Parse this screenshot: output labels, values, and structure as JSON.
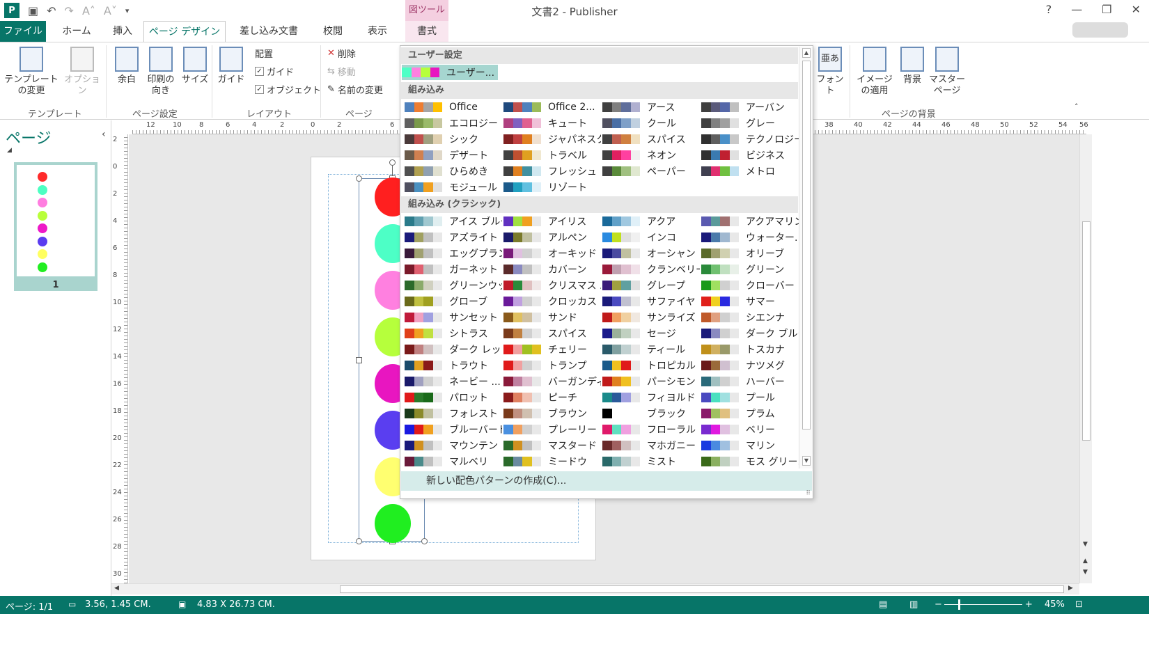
{
  "window": {
    "title": "文書2 - Publisher",
    "context_tool_label": "図ツール",
    "help": "?",
    "minimize": "—",
    "restore": "❐",
    "close": "✕"
  },
  "tabs": [
    {
      "label": "ファイル"
    },
    {
      "label": "ホーム"
    },
    {
      "label": "挿入"
    },
    {
      "label": "ページ デザイン"
    },
    {
      "label": "差し込み文書"
    },
    {
      "label": "校閲"
    },
    {
      "label": "表示"
    },
    {
      "label": "書式"
    }
  ],
  "ribbon": {
    "template_change": "テンプレートの変更",
    "options": "オプション",
    "margins": "余白",
    "orientation": "印刷の向き",
    "size": "サイズ",
    "guides": "ガイド",
    "align_label": "配置",
    "align_guides": "ガイド",
    "align_objects": "オブジェクト",
    "delete": "削除",
    "move": "移動",
    "rename": "名前の変更",
    "fonts": "フォント",
    "fonts_icon_text": "亜あ",
    "apply_image": "イメージの適用",
    "background": "背景",
    "master_pages": "マスター ページ",
    "groups": {
      "template": "テンプレート",
      "page_setup": "ページ設定",
      "layout": "レイアウト",
      "pages": "ページ",
      "page_background": "ページの背景"
    }
  },
  "pages_pane": {
    "title": "ページ",
    "thumb_number": "1",
    "thumb_dot_colors": [
      "#ff2a2a",
      "#4dffc2",
      "#ff7de0",
      "#b9ff3a",
      "#ee1ac8",
      "#5a3cf0",
      "#ffff60",
      "#22ee22"
    ]
  },
  "canvas": {
    "circle_colors": [
      "#ff1f1f",
      "#4dffc6",
      "#ff80e0",
      "#b6ff3c",
      "#e816c0",
      "#5a3ef0",
      "#ffff70",
      "#20ee20"
    ]
  },
  "hruler_numbers": [
    "12",
    "10",
    "8",
    "6",
    "4",
    "2",
    "0",
    "2",
    "6",
    "38",
    "40",
    "42",
    "44",
    "46",
    "48",
    "50",
    "52",
    "54",
    "56"
  ],
  "vruler_numbers": [
    "2",
    "0",
    "2",
    "4",
    "6",
    "8",
    "10",
    "12",
    "14",
    "16",
    "18",
    "20",
    "22",
    "24",
    "26",
    "28",
    "30"
  ],
  "dropdown": {
    "section_custom": "ユーザー設定",
    "section_builtin": "組み込み",
    "section_classic": "組み込み (クラシック)",
    "create_new": "新しい配色パターンの作成(C)...",
    "custom": [
      {
        "name": "ユーザー...",
        "colors": [
          "#4dffc6",
          "#ff80e0",
          "#b6ff3c",
          "#e816c0"
        ],
        "selected": true
      }
    ],
    "builtin": [
      {
        "name": "Office",
        "colors": [
          "#4f81bd",
          "#ed7d31",
          "#a5a5a5",
          "#ffc000"
        ]
      },
      {
        "name": "Office 2...",
        "colors": [
          "#1f497d",
          "#c0504d",
          "#4f81bd",
          "#9bbb59"
        ]
      },
      {
        "name": "アース",
        "colors": [
          "#404040",
          "#7f7f7f",
          "#5f6e9b",
          "#b0b0d0"
        ]
      },
      {
        "name": "アーバン",
        "colors": [
          "#404040",
          "#5b5b7b",
          "#5567a8",
          "#c0c0c0"
        ]
      },
      {
        "name": "エコロジー",
        "colors": [
          "#606060",
          "#7a9a4a",
          "#9aba6a",
          "#c8c8a0"
        ]
      },
      {
        "name": "キュート",
        "colors": [
          "#b04080",
          "#8060c0",
          "#e06090",
          "#f0c0d8"
        ]
      },
      {
        "name": "クール",
        "colors": [
          "#505060",
          "#4a6fa5",
          "#7fa0c8",
          "#c0d0e0"
        ]
      },
      {
        "name": "グレー",
        "colors": [
          "#404040",
          "#808080",
          "#a0a0a0",
          "#e0e0e0"
        ]
      },
      {
        "name": "シック",
        "colors": [
          "#4a3a3a",
          "#c0504d",
          "#a0a080",
          "#e0d0b0"
        ]
      },
      {
        "name": "ジャパネスク",
        "colors": [
          "#802020",
          "#c04040",
          "#e08020",
          "#f0e0d0"
        ]
      },
      {
        "name": "スパイス",
        "colors": [
          "#404040",
          "#c06050",
          "#d08040",
          "#f0e0c0"
        ]
      },
      {
        "name": "テクノロジー",
        "colors": [
          "#303030",
          "#5f5f5f",
          "#4a90c8",
          "#c8c8c8"
        ]
      },
      {
        "name": "デザート",
        "colors": [
          "#6a5a4a",
          "#d08050",
          "#90a0c0",
          "#e0d8c8"
        ]
      },
      {
        "name": "トラベル",
        "colors": [
          "#404040",
          "#c05030",
          "#e0a020",
          "#f0e8d0"
        ]
      },
      {
        "name": "ネオン",
        "colors": [
          "#404040",
          "#e02060",
          "#ff40a0",
          "#f0f0f0"
        ]
      },
      {
        "name": "ビジネス",
        "colors": [
          "#303030",
          "#3a7ab0",
          "#c02030",
          "#e0e0e0"
        ]
      },
      {
        "name": "ひらめき",
        "colors": [
          "#505050",
          "#b0a050",
          "#90a0b0",
          "#e0e0d0"
        ]
      },
      {
        "name": "フレッシュ",
        "colors": [
          "#404040",
          "#e08020",
          "#4090a0",
          "#d0e8f0"
        ]
      },
      {
        "name": "ペーパー",
        "colors": [
          "#404040",
          "#5a8a3a",
          "#a0c080",
          "#e0e8d0"
        ]
      },
      {
        "name": "メトロ",
        "colors": [
          "#404050",
          "#e03070",
          "#70c040",
          "#c0e0f0"
        ]
      },
      {
        "name": "モジュール",
        "colors": [
          "#505060",
          "#4a90c0",
          "#f0a020",
          "#e0e0e0"
        ]
      },
      {
        "name": "リゾート",
        "colors": [
          "#1a5a8a",
          "#20a0c0",
          "#60c0e0",
          "#e0f0f8"
        ]
      }
    ],
    "classic": [
      {
        "name": "アイス ブルー",
        "colors": [
          "#2a7a8a",
          "#60a0b0",
          "#a0c8d0",
          "#e0eef0"
        ]
      },
      {
        "name": "アイリス",
        "colors": [
          "#6030c0",
          "#a0e040",
          "#f0a020",
          "#e8e8e8"
        ]
      },
      {
        "name": "アクア",
        "colors": [
          "#1a6a9a",
          "#60a0c8",
          "#a0c8e0",
          "#e0f0f8"
        ]
      },
      {
        "name": "アクアマリン",
        "colors": [
          "#5a5ab0",
          "#5a9a9a",
          "#a07070",
          "#e8e8e8"
        ]
      },
      {
        "name": "アズライト",
        "colors": [
          "#1a1a7a",
          "#a0a060",
          "#c0c0c0",
          "#e8e8e8"
        ]
      },
      {
        "name": "アルペン",
        "colors": [
          "#1a1a6a",
          "#7a7a2a",
          "#c0c0a0",
          "#e8e8e8"
        ]
      },
      {
        "name": "インコ",
        "colors": [
          "#2a8ae0",
          "#c0e020",
          "#e0e0e0",
          "#f0f0f0"
        ]
      },
      {
        "name": "ウォーター...",
        "colors": [
          "#1a1a7a",
          "#4a7aaa",
          "#a0b8d0",
          "#e8e8e8"
        ]
      },
      {
        "name": "エッグプラント",
        "colors": [
          "#3a1a3a",
          "#a0a070",
          "#c0c0c0",
          "#e8e8e8"
        ]
      },
      {
        "name": "オーキッド",
        "colors": [
          "#7a1a7a",
          "#e0c0e0",
          "#d0d0d0",
          "#e8e8e8"
        ]
      },
      {
        "name": "オーシャン",
        "colors": [
          "#1a1a7a",
          "#4a4aa0",
          "#c0c0a0",
          "#e8e8e8"
        ]
      },
      {
        "name": "オリーブ",
        "colors": [
          "#5a6a2a",
          "#a0a070",
          "#d0d0b0",
          "#e8e8e8"
        ]
      },
      {
        "name": "ガーネット",
        "colors": [
          "#7a1a2a",
          "#e06070",
          "#c0c0c0",
          "#e8e8e8"
        ]
      },
      {
        "name": "カバーン",
        "colors": [
          "#5a2a2a",
          "#8a8ac0",
          "#c0c0c0",
          "#e8e8e8"
        ]
      },
      {
        "name": "クランベリー",
        "colors": [
          "#9a1a3a",
          "#c0a0b0",
          "#e0c0d0",
          "#f0e0e8"
        ]
      },
      {
        "name": "グリーン",
        "colors": [
          "#2a8a3a",
          "#70c070",
          "#c0e0c0",
          "#e8f0e8"
        ]
      },
      {
        "name": "グリーンウッド",
        "colors": [
          "#2a6a2a",
          "#8aaa6a",
          "#d0d0c0",
          "#e8e8e8"
        ]
      },
      {
        "name": "クリスマス ...",
        "colors": [
          "#c01a2a",
          "#2a8a3a",
          "#e0c0c0",
          "#f0e8e8"
        ]
      },
      {
        "name": "グレープ",
        "colors": [
          "#3a1a7a",
          "#a0a040",
          "#60a0a0",
          "#e0e0e0"
        ]
      },
      {
        "name": "クローバー",
        "colors": [
          "#1a9a1a",
          "#a0e060",
          "#d0d0d0",
          "#e8e8e8"
        ]
      },
      {
        "name": "グローブ",
        "colors": [
          "#6a6a1a",
          "#c0c040",
          "#a0a020",
          "#e8e8e8"
        ]
      },
      {
        "name": "クロッカス",
        "colors": [
          "#6a1a9a",
          "#c0a0e0",
          "#d0d0d0",
          "#e8e8e8"
        ]
      },
      {
        "name": "サファイヤ",
        "colors": [
          "#1a1a7a",
          "#4a4ac0",
          "#c0c0d0",
          "#e8e8e8"
        ]
      },
      {
        "name": "サマー",
        "colors": [
          "#e0201a",
          "#f0d020",
          "#2a2ae0",
          "#e8e8e8"
        ]
      },
      {
        "name": "サンセット",
        "colors": [
          "#c01a3a",
          "#f0a0c0",
          "#a0a0e0",
          "#e8e8e8"
        ]
      },
      {
        "name": "サンド",
        "colors": [
          "#8a5a1a",
          "#e0c060",
          "#d0c0a0",
          "#e8e8e8"
        ]
      },
      {
        "name": "サンライズ",
        "colors": [
          "#c01a1a",
          "#f0a060",
          "#f0d0a0",
          "#f0e8e0"
        ]
      },
      {
        "name": "シエンナ",
        "colors": [
          "#c05a2a",
          "#e0a080",
          "#d0d0d0",
          "#e8e8e8"
        ]
      },
      {
        "name": "シトラス",
        "colors": [
          "#e0401a",
          "#f0a020",
          "#c0e040",
          "#e8e8e8"
        ]
      },
      {
        "name": "スパイス",
        "colors": [
          "#7a3a1a",
          "#c08040",
          "#d0d0d0",
          "#e8e8e8"
        ]
      },
      {
        "name": "セージ",
        "colors": [
          "#1a1a8a",
          "#9ab09a",
          "#c0d0c0",
          "#e8e8e8"
        ]
      },
      {
        "name": "ダーク ブルー",
        "colors": [
          "#1a1a7a",
          "#8a8ac0",
          "#d0d0d0",
          "#e8e8e8"
        ]
      },
      {
        "name": "ダーク レッド",
        "colors": [
          "#7a1a1a",
          "#c08080",
          "#d0c0c0",
          "#e8e8e8"
        ]
      },
      {
        "name": "チェリー",
        "colors": [
          "#e01a1a",
          "#f0a0a0",
          "#a0c020",
          "#e0c020"
        ]
      },
      {
        "name": "ティール",
        "colors": [
          "#2a5a6a",
          "#80a0a0",
          "#c0d0d0",
          "#e8e8e8"
        ]
      },
      {
        "name": "トスカナ",
        "colors": [
          "#c0901a",
          "#d0b060",
          "#9a9a6a",
          "#e8e8e8"
        ]
      },
      {
        "name": "トラウト",
        "colors": [
          "#1a4a6a",
          "#e0a020",
          "#8a1a1a",
          "#e8e8e8"
        ]
      },
      {
        "name": "トランプ",
        "colors": [
          "#e01a1a",
          "#f0a0a0",
          "#d0d0d0",
          "#e8e8e8"
        ]
      },
      {
        "name": "トロピカル",
        "colors": [
          "#1a5a8a",
          "#f0c020",
          "#e01a1a",
          "#e8e8e8"
        ]
      },
      {
        "name": "ナツメグ",
        "colors": [
          "#6a1a1a",
          "#9a6a3a",
          "#d0c0d0",
          "#e8e8e8"
        ]
      },
      {
        "name": "ネービー ...",
        "colors": [
          "#1a1a6a",
          "#a0a0c0",
          "#d0d0d0",
          "#e8e8e8"
        ]
      },
      {
        "name": "バーガンディ",
        "colors": [
          "#8a1a3a",
          "#c080a0",
          "#e0c0d0",
          "#e8e8e8"
        ]
      },
      {
        "name": "パーシモン",
        "colors": [
          "#c01a1a",
          "#e08020",
          "#f0c020",
          "#e8e8e8"
        ]
      },
      {
        "name": "ハーバー",
        "colors": [
          "#2a6a7a",
          "#a0c0c0",
          "#d0d0d0",
          "#e8e8e8"
        ]
      },
      {
        "name": "パロット",
        "colors": [
          "#e01a1a",
          "#2a7a2a",
          "#1a6a1a",
          "#e8e8e8"
        ]
      },
      {
        "name": "ピーチ",
        "colors": [
          "#8a1a1a",
          "#e08060",
          "#f0c0b0",
          "#e8e8e8"
        ]
      },
      {
        "name": "フィヨルド",
        "colors": [
          "#1a8a8a",
          "#2a5a9a",
          "#a0a0e0",
          "#e8e8e8"
        ]
      },
      {
        "name": "プール",
        "colors": [
          "#4a4ac0",
          "#4ae0c0",
          "#a0e0e0",
          "#e8e8e8"
        ]
      },
      {
        "name": "フォレスト",
        "colors": [
          "#1a3a1a",
          "#8a8a2a",
          "#c0c0a0",
          "#e8e8e8"
        ]
      },
      {
        "name": "ブラウン",
        "colors": [
          "#7a3a1a",
          "#c09080",
          "#d0c0b0",
          "#e8e8e8"
        ]
      },
      {
        "name": "ブラック",
        "colors": [
          "#000000",
          "#ffffff",
          "#ffffff",
          "#ffffff"
        ]
      },
      {
        "name": "プラム",
        "colors": [
          "#8a1a6a",
          "#a0c060",
          "#e0c080",
          "#e8e8e8"
        ]
      },
      {
        "name": "ブルーバード",
        "colors": [
          "#1a1ae0",
          "#e01a1a",
          "#f0a020",
          "#e8e8e8"
        ]
      },
      {
        "name": "プレーリー",
        "colors": [
          "#4a90e0",
          "#f0a060",
          "#d0d0d0",
          "#e8e8e8"
        ]
      },
      {
        "name": "フローラル",
        "colors": [
          "#e01a6a",
          "#60e0c0",
          "#f0a0e0",
          "#e8e8e8"
        ]
      },
      {
        "name": "ベリー",
        "colors": [
          "#7a2ad0",
          "#e01ae0",
          "#e0c0e0",
          "#e8e8e8"
        ]
      },
      {
        "name": "マウンテン",
        "colors": [
          "#1a1a7a",
          "#d09020",
          "#c0c0c0",
          "#e8e8e8"
        ]
      },
      {
        "name": "マスタード",
        "colors": [
          "#2a6a2a",
          "#d09020",
          "#c0c0c0",
          "#e8e8e8"
        ]
      },
      {
        "name": "マホガニー",
        "colors": [
          "#6a2a2a",
          "#a06060",
          "#d0c0c0",
          "#e8e8e8"
        ]
      },
      {
        "name": "マリン",
        "colors": [
          "#1a3ae0",
          "#4a8ae0",
          "#a0c0e0",
          "#e8e8e8"
        ]
      },
      {
        "name": "マルベリ",
        "colors": [
          "#6a1a3a",
          "#4a8a8a",
          "#c0c0c0",
          "#e8e8e8"
        ]
      },
      {
        "name": "ミードウ",
        "colors": [
          "#2a6a2a",
          "#6a8aa0",
          "#e0c020",
          "#e8e8e8"
        ]
      },
      {
        "name": "ミスト",
        "colors": [
          "#2a6a6a",
          "#80b0b0",
          "#c0d0d0",
          "#e8e8e8"
        ]
      },
      {
        "name": "モス グリーン",
        "colors": [
          "#3a6a1a",
          "#8ab060",
          "#c0d0c0",
          "#e8e8e8"
        ]
      }
    ]
  },
  "status": {
    "page": "ページ: 1/1",
    "position": "3.56, 1.45 CM.",
    "size": "4.83 X 26.73 CM.",
    "zoom": "45%"
  }
}
